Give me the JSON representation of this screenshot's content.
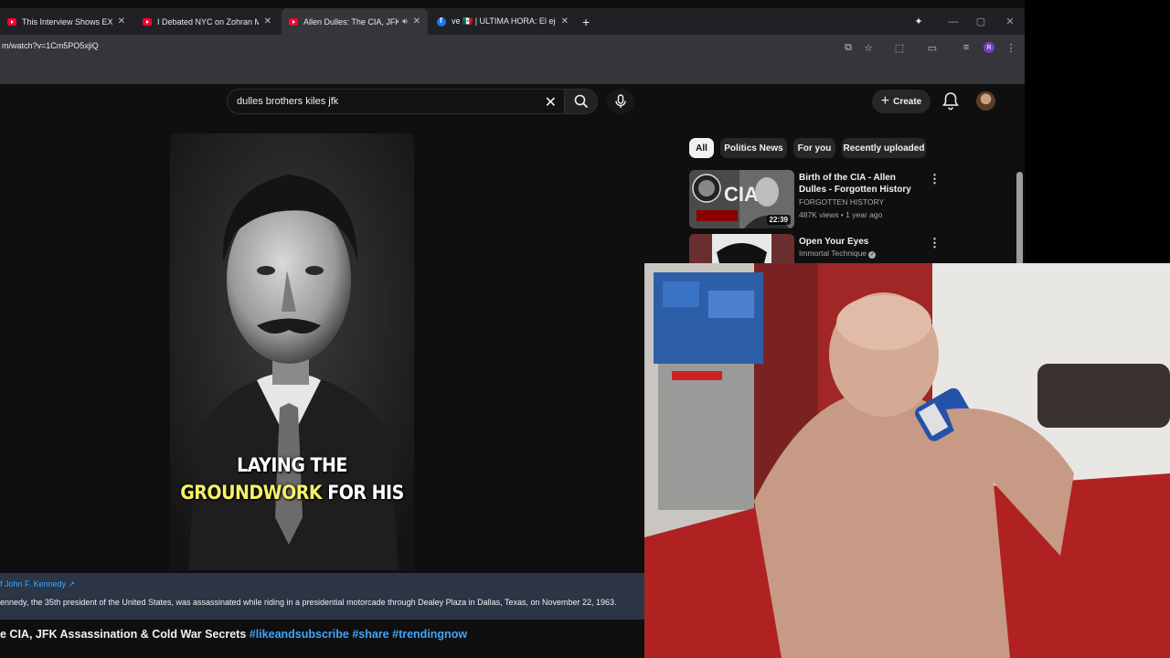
{
  "browser": {
    "tabs": [
      {
        "title": "This Interview Shows EXACTLY W",
        "icon": "youtube-icon",
        "active": false
      },
      {
        "title": "I Debated NYC on Zohran Mam",
        "icon": "youtube-icon",
        "active": false
      },
      {
        "title": "Allen Dulles: The CIA, JFK A",
        "icon": "youtube-icon",
        "active": true
      },
      {
        "title": "ve 🇲🇽 | ULTIMA HORA: El ejército",
        "icon": "facebook-icon",
        "active": false
      }
    ],
    "new_tab": "+",
    "url": "m/watch?v=1Cm5PO5xjiQ",
    "profile_initial": "R"
  },
  "youtube": {
    "search_query": "dulles brothers kiles jfk",
    "create_label": "Create",
    "chips": [
      "All",
      "Politics News",
      "For you",
      "Recently uploaded"
    ],
    "recommendations": [
      {
        "title": "Birth of the CIA - Allen Dulles - Forgotten History",
        "channel": "FORGOTTEN HISTORY",
        "meta": "487K views • 1 year ago",
        "duration": "22:39",
        "thumb_text": "CIA"
      },
      {
        "title": "Open Your Eyes",
        "channel": "Immortal Technique",
        "meta": "",
        "duration": "",
        "verified": true
      }
    ],
    "video": {
      "caption_line1": "LAYING THE",
      "caption_highlight": "GROUNDWORK",
      "caption_rest": "FOR HIS",
      "info_link": "f John F. Kennedy",
      "info_text": "ennedy, the 35th president of the United States, was assassinated while riding in a presidential motorcade through Dealey Plaza in Dallas, Texas, on November 22, 1963.",
      "title_main": "e CIA, JFK Assassination & Cold War Secrets",
      "title_tags": "#likeandsubscribe #share #trendingnow"
    }
  },
  "colors": {
    "youtube_red": "#ff0033",
    "link_blue": "#3ea6ff",
    "caption_yellow": "#f4f06a",
    "info_panel": "#2b3545"
  }
}
